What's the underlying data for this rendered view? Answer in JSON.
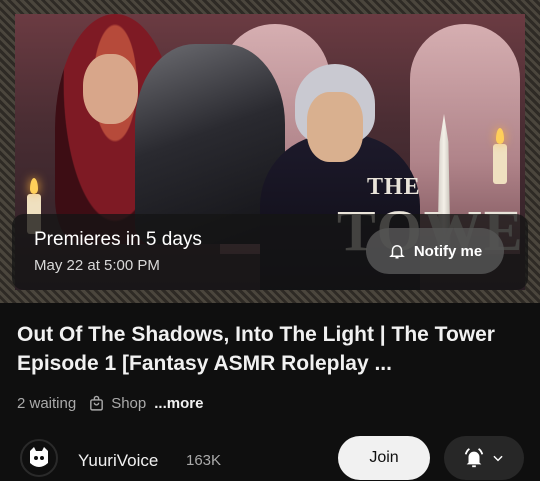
{
  "thumbnail": {
    "logo_the": "THE",
    "logo_word": "TOWER"
  },
  "premiere": {
    "title": "Premieres in 5 days",
    "date": "May 22 at 5:00 PM",
    "notify_label": "Notify me",
    "notify_icon": "bell-outline-icon"
  },
  "video": {
    "title": "Out Of The Shadows, Into The Light | The Tower Episode 1 [Fantasy ASMR Roleplay ...",
    "waiting": "2 waiting",
    "shop_label": "Shop",
    "shop_icon": "shopping-bag-icon",
    "more_label": "...more"
  },
  "channel": {
    "name": "YuuriVoice",
    "subscribers": "163K",
    "join_label": "Join",
    "bell_icon": "bell-filled-icon",
    "dropdown_icon": "chevron-down-icon"
  },
  "colors": {
    "background": "#0f0f0f",
    "primary_text": "#f1f1f1",
    "secondary_text": "#aaaaaa",
    "join_button_bg": "#f1f1f1",
    "bell_button_bg": "#272727"
  }
}
